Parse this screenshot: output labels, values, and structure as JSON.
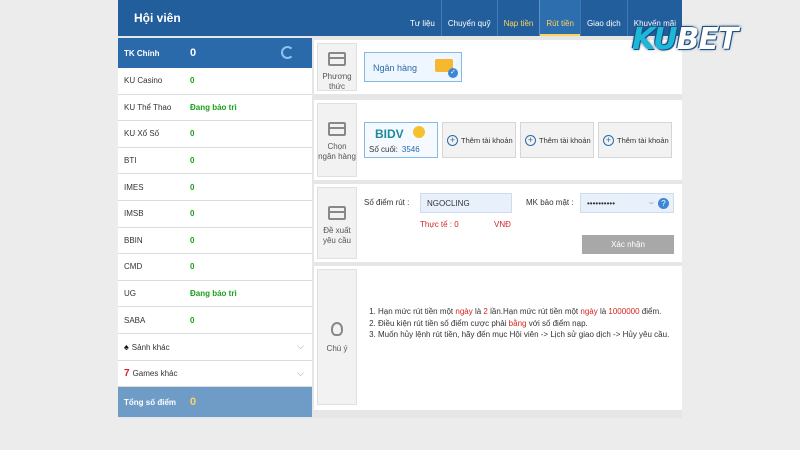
{
  "header": {
    "title": "Hội viên"
  },
  "nav": [
    {
      "label": "Tư liệu",
      "state": "normal"
    },
    {
      "label": "Chuyển quỹ",
      "state": "normal"
    },
    {
      "label": "Nạp tiền",
      "state": "highlight"
    },
    {
      "label": "Rút tiền",
      "state": "active"
    },
    {
      "label": "Giao dịch",
      "state": "normal"
    },
    {
      "label": "Khuyến mãi",
      "state": "normal"
    }
  ],
  "logo": {
    "part1": "KU",
    "part2": "BET"
  },
  "sidebar": {
    "head": {
      "label": "TK Chính",
      "value": "0"
    },
    "items": [
      {
        "label": "KU Casino",
        "value": "0"
      },
      {
        "label": "KU Thể Thao",
        "value": "Đang bảo trì"
      },
      {
        "label": "KU Xổ Số",
        "value": "0"
      },
      {
        "label": "BTI",
        "value": "0"
      },
      {
        "label": "IMES",
        "value": "0"
      },
      {
        "label": "IMSB",
        "value": "0"
      },
      {
        "label": "BBIN",
        "value": "0"
      },
      {
        "label": "CMD",
        "value": "0"
      },
      {
        "label": "UG",
        "value": "Đang bảo trì"
      },
      {
        "label": "SABA",
        "value": "0"
      }
    ],
    "lobby_other": "Sảnh khác",
    "games_other": "Games khác",
    "total": {
      "label": "Tổng số điểm",
      "value": "0"
    }
  },
  "method": {
    "tile": "Phương thức",
    "bank_label": "Ngân hàng"
  },
  "bank_select": {
    "tile": "Chọn ngân hàng",
    "bank_name": "BIDV",
    "last_digits_label": "Số cuối:",
    "last_digits": "3546",
    "add_account": "Thêm tài khoản"
  },
  "request": {
    "tile": "Đề xuất yêu cầu",
    "amount_label": "Số điểm rút :",
    "amount_value": "NGOCLING",
    "security_label": "MK bảo mật :",
    "security_value": "••••••••••",
    "actual_label": "Thực tế : 0",
    "currency": "VNĐ",
    "confirm": "Xác nhận"
  },
  "notes": {
    "tile": "Chú ý",
    "n1_a": "Hạn mức rút tiền một ",
    "n1_b": "ngày",
    "n1_c": " là ",
    "n1_d": "2",
    "n1_e": " lần.Hạn mức rút tiền một ",
    "n1_f": "ngày",
    "n1_g": " là ",
    "n1_h": "1000000",
    "n1_i": " điểm.",
    "n2_a": "Điều kiện rút tiền số điểm cược phải ",
    "n2_b": "bằng",
    "n2_c": " với số điểm nạp.",
    "n3": "Muốn hủy lệnh rút tiền, hãy đến mục Hội viên -> Lịch sử giao dịch -> Hủy yêu cầu."
  },
  "colors": {
    "header": "#215e9b",
    "accent": "#ffd35a",
    "ok_green": "#1ba21b",
    "warn_red": "#d62424"
  }
}
